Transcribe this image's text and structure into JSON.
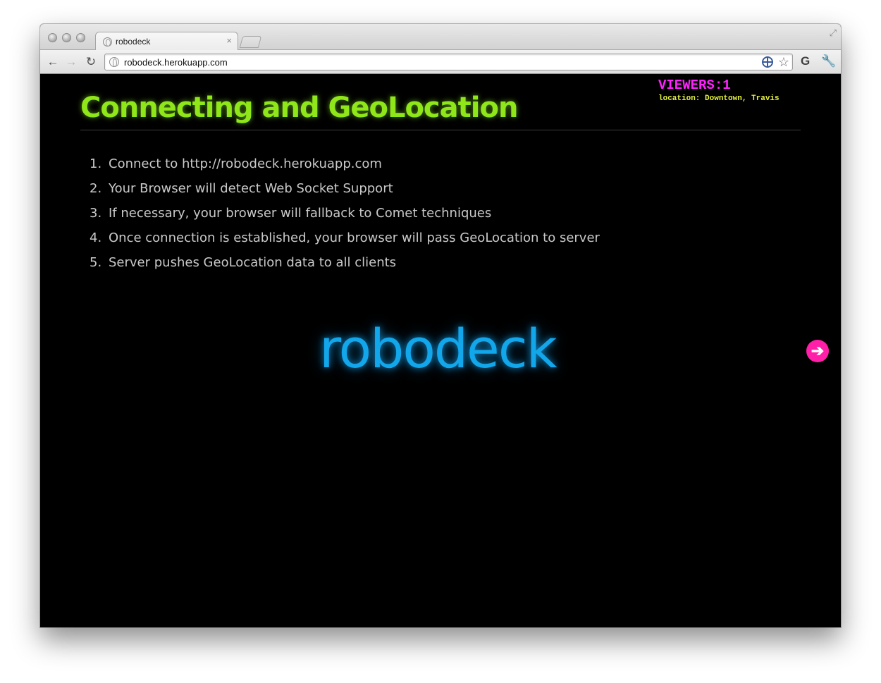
{
  "browser": {
    "tab_title": "robodeck",
    "tab_close": "×",
    "url": "robodeck.herokuapp.com",
    "nav": {
      "back": "←",
      "forward": "→",
      "reload": "↻"
    },
    "star": "☆",
    "gplus": "G",
    "wrench": "🔧",
    "resize": "⤢"
  },
  "slide": {
    "title": "Connecting and GeoLocation",
    "viewers_label": "VIEWERS:1",
    "location_text": "location: Downtown, Travis",
    "steps": [
      {
        "num": "1.",
        "text": "Connect to http://robodeck.herokuapp.com"
      },
      {
        "num": "2.",
        "text": "Your Browser will detect Web Socket Support"
      },
      {
        "num": "3.",
        "text": "If necessary, your browser will fallback to Comet techniques"
      },
      {
        "num": "4.",
        "text": "Once connection is established, your browser will pass GeoLocation to server"
      },
      {
        "num": "5.",
        "text": "Server pushes GeoLocation data to all clients"
      }
    ],
    "logo": "robodeck",
    "next_arrow": "➔"
  },
  "colors": {
    "title": "#8fe619",
    "viewers": "#ff22ff",
    "location": "#e6f23c",
    "logo": "#12a6ea",
    "next_button": "#ff1fa8",
    "background": "#000000"
  }
}
